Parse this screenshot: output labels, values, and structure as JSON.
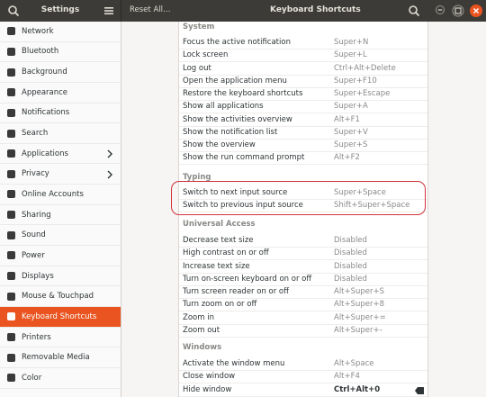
{
  "titlebar": {
    "app_title": "Settings",
    "reset_label": "Reset All…",
    "panel_title": "Keyboard Shortcuts"
  },
  "sidebar": {
    "items": [
      {
        "label": "Network",
        "icon": "network-icon"
      },
      {
        "label": "Bluetooth",
        "icon": "bluetooth-icon"
      },
      {
        "label": "Background",
        "icon": "background-icon"
      },
      {
        "label": "Appearance",
        "icon": "appearance-icon"
      },
      {
        "label": "Notifications",
        "icon": "bell-icon"
      },
      {
        "label": "Search",
        "icon": "search-icon"
      },
      {
        "label": "Applications",
        "icon": "apps-icon",
        "chevron": true
      },
      {
        "label": "Privacy",
        "icon": "privacy-icon",
        "chevron": true
      },
      {
        "label": "Online Accounts",
        "icon": "online-accounts-icon"
      },
      {
        "label": "Sharing",
        "icon": "share-icon"
      },
      {
        "label": "Sound",
        "icon": "sound-icon"
      },
      {
        "label": "Power",
        "icon": "power-icon"
      },
      {
        "label": "Displays",
        "icon": "display-icon"
      },
      {
        "label": "Mouse & Touchpad",
        "icon": "mouse-icon"
      },
      {
        "label": "Keyboard Shortcuts",
        "icon": "keyboard-icon",
        "active": true
      },
      {
        "label": "Printers",
        "icon": "printer-icon"
      },
      {
        "label": "Removable Media",
        "icon": "media-icon"
      },
      {
        "label": "Color",
        "icon": "color-icon"
      }
    ]
  },
  "shortcuts": {
    "system": {
      "title": "System",
      "rows": [
        {
          "name": "Focus the active notification",
          "keys": "Super+N"
        },
        {
          "name": "Lock screen",
          "keys": "Super+L"
        },
        {
          "name": "Log out",
          "keys": "Ctrl+Alt+Delete"
        },
        {
          "name": "Open the application menu",
          "keys": "Super+F10"
        },
        {
          "name": "Restore the keyboard shortcuts",
          "keys": "Super+Escape"
        },
        {
          "name": "Show all applications",
          "keys": "Super+A"
        },
        {
          "name": "Show the activities overview",
          "keys": "Alt+F1"
        },
        {
          "name": "Show the notification list",
          "keys": "Super+V"
        },
        {
          "name": "Show the overview",
          "keys": "Super+S"
        },
        {
          "name": "Show the run command prompt",
          "keys": "Alt+F2"
        }
      ]
    },
    "typing": {
      "title": "Typing",
      "rows": [
        {
          "name": "Switch to next input source",
          "keys": "Super+Space"
        },
        {
          "name": "Switch to previous input source",
          "keys": "Shift+Super+Space"
        }
      ]
    },
    "universal": {
      "title": "Universal Access",
      "rows": [
        {
          "name": "Decrease text size",
          "keys": "Disabled"
        },
        {
          "name": "High contrast on or off",
          "keys": "Disabled"
        },
        {
          "name": "Increase text size",
          "keys": "Disabled"
        },
        {
          "name": "Turn on-screen keyboard on or off",
          "keys": "Disabled"
        },
        {
          "name": "Turn screen reader on or off",
          "keys": "Alt+Super+S"
        },
        {
          "name": "Turn zoom on or off",
          "keys": "Alt+Super+8"
        },
        {
          "name": "Zoom in",
          "keys": "Alt+Super+="
        },
        {
          "name": "Zoom out",
          "keys": "Alt+Super+-"
        }
      ]
    },
    "windows": {
      "title": "Windows",
      "rows": [
        {
          "name": "Activate the window menu",
          "keys": "Alt+Space"
        },
        {
          "name": "Close window",
          "keys": "Alt+F4"
        },
        {
          "name": "Hide window",
          "keys": "Ctrl+Alt+0"
        }
      ]
    }
  },
  "colors": {
    "accent": "#e95420",
    "titlebar": "#3c3b37",
    "highlight_border": "#d0323a"
  }
}
